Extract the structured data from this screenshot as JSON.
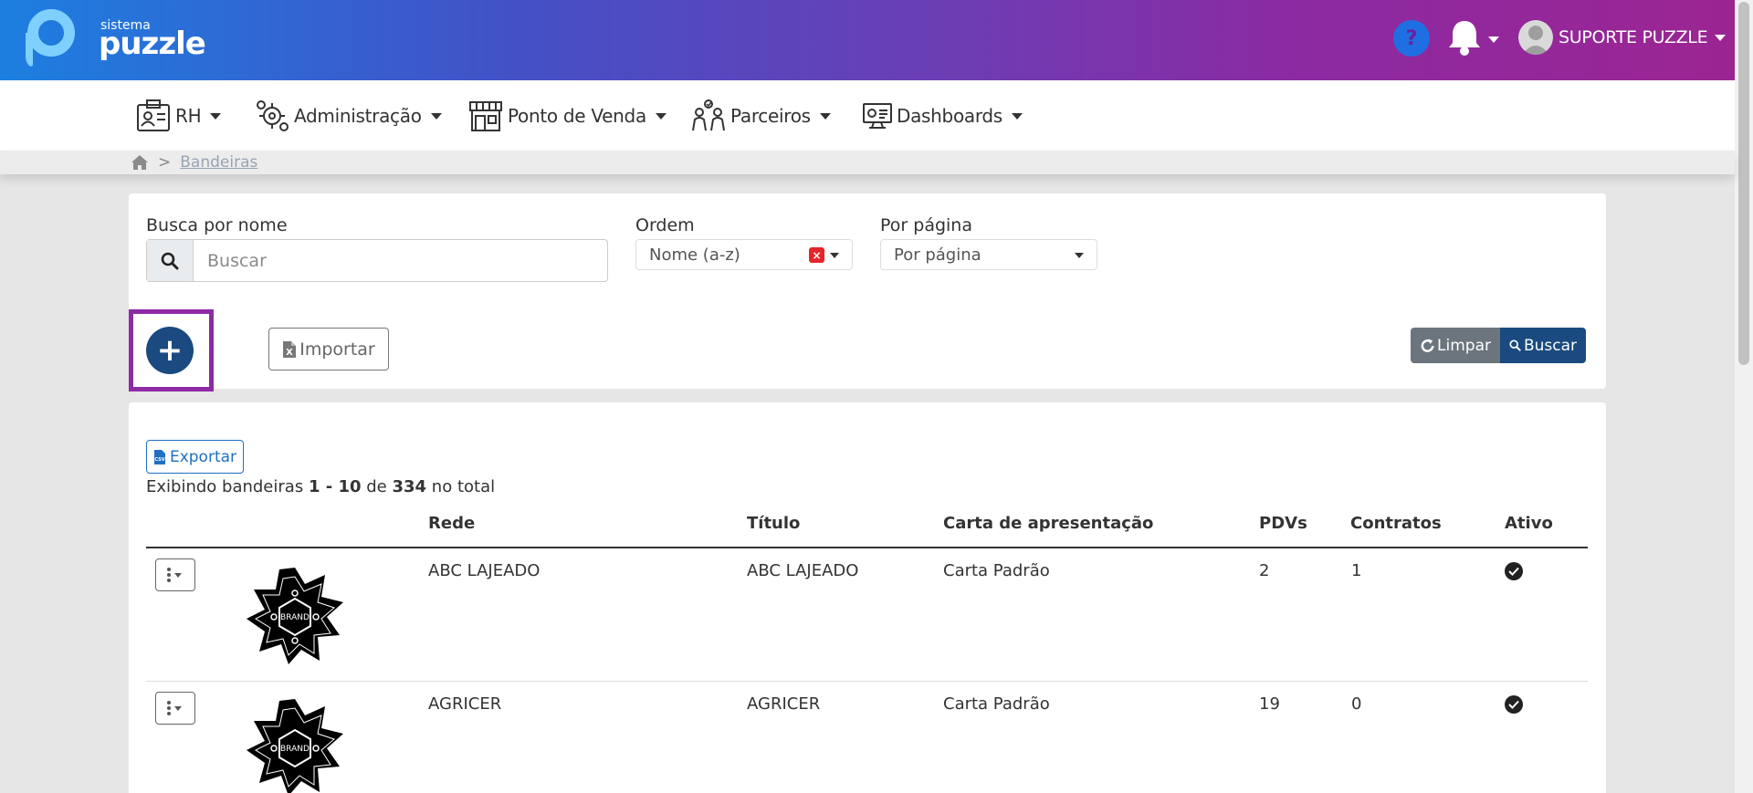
{
  "header": {
    "logo_small": "sistema",
    "logo_big": "puzzle",
    "user_name": "SUPORTE PUZZLE"
  },
  "nav": {
    "items": [
      {
        "label": "RH",
        "icon": "id-card-icon"
      },
      {
        "label": "Administração",
        "icon": "gears-icon"
      },
      {
        "label": "Ponto de Venda",
        "icon": "store-icon"
      },
      {
        "label": "Parceiros",
        "icon": "partners-icon"
      },
      {
        "label": "Dashboards",
        "icon": "dashboard-monitor-icon"
      }
    ]
  },
  "breadcrumb": {
    "sep": ">",
    "current": "Bandeiras"
  },
  "filters": {
    "search_label": "Busca por nome",
    "search_placeholder": "Buscar",
    "order_label": "Ordem",
    "order_value": "Nome (a-z)",
    "per_page_label": "Por página",
    "per_page_value": "Por página"
  },
  "actions": {
    "add": "+",
    "import": "Importar",
    "clear": "Limpar",
    "search": "Buscar",
    "export": "Exportar"
  },
  "summary": {
    "prefix": "Exibindo bandeiras",
    "range": "1 - 10",
    "of": "de",
    "total": "334",
    "suffix": "no total"
  },
  "table": {
    "columns": [
      "Rede",
      "Título",
      "Carta de apresentação",
      "PDVs",
      "Contratos",
      "Ativo"
    ],
    "rows": [
      {
        "rede": "ABC LAJEADO",
        "titulo": "ABC LAJEADO",
        "carta": "Carta Padrão",
        "pdvs": "2",
        "contratos": "1",
        "ativo": true
      },
      {
        "rede": "AGRICER",
        "titulo": "AGRICER",
        "carta": "Carta Padrão",
        "pdvs": "19",
        "contratos": "0",
        "ativo": true
      }
    ]
  },
  "colors": {
    "accent": "#1a4a80",
    "highlight": "#8e2aa6",
    "header_start": "#1c7fe0",
    "header_end": "#9b2592"
  }
}
